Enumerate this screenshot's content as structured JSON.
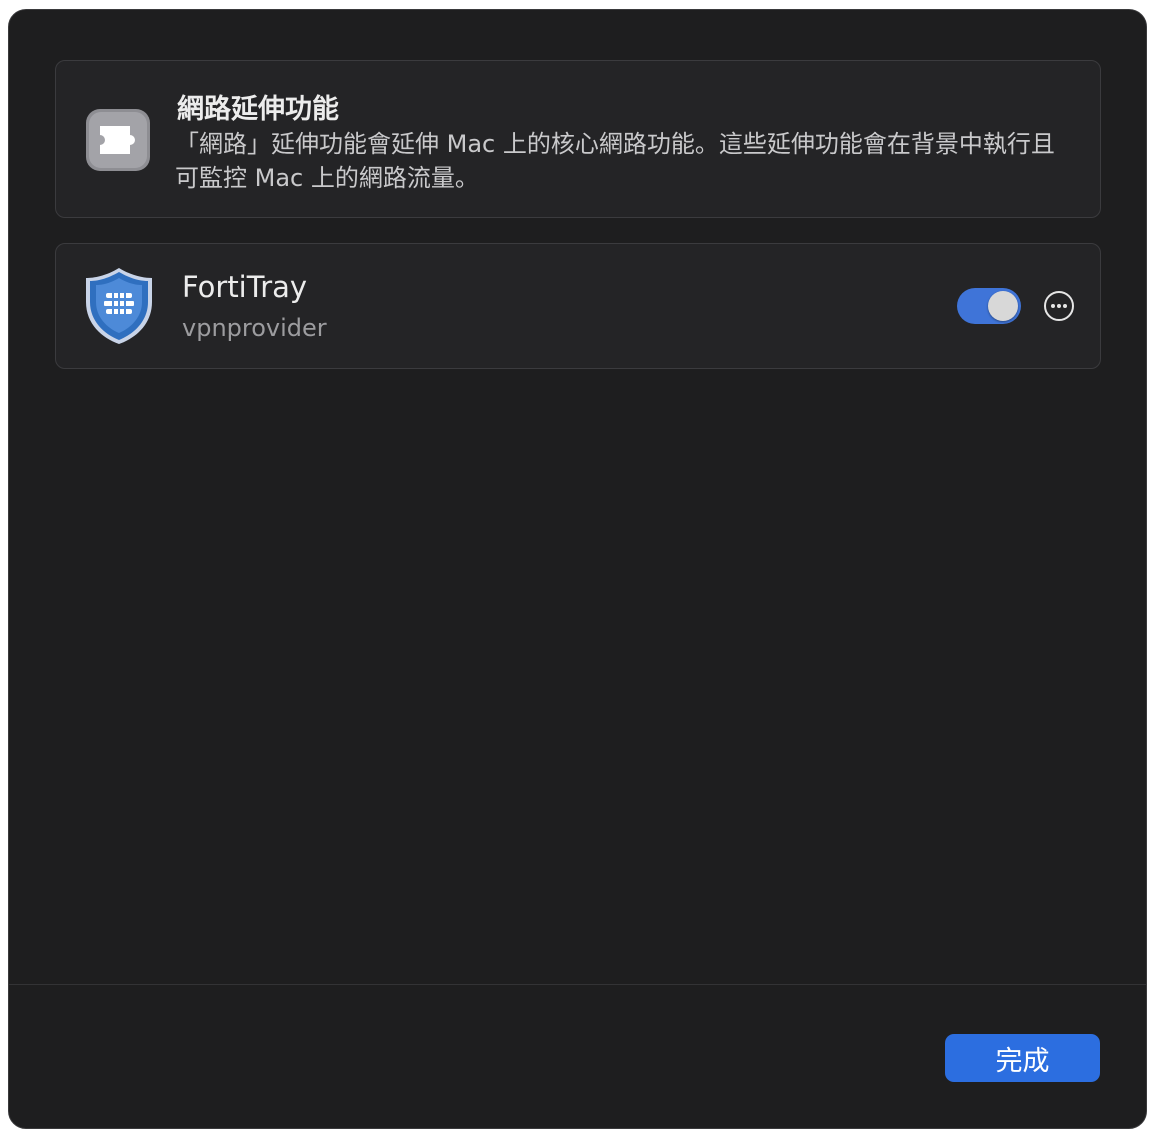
{
  "header": {
    "icon": "extension-puzzle-icon",
    "title": "網路延伸功能",
    "description": "「網路」延伸功能會延伸 Mac 上的核心網路功能。這些延伸功能會在背景中執行且可監控 Mac 上的網路流量。"
  },
  "extensions": [
    {
      "icon": "fortinet-shield-icon",
      "name": "FortiTray",
      "subtitle": "vpnprovider",
      "enabled": true
    }
  ],
  "footer": {
    "done_label": "完成"
  },
  "colors": {
    "accent": "#2c6ee0",
    "toggle_on": "#3f74d8",
    "background": "#1e1e1f",
    "card": "#242426"
  }
}
